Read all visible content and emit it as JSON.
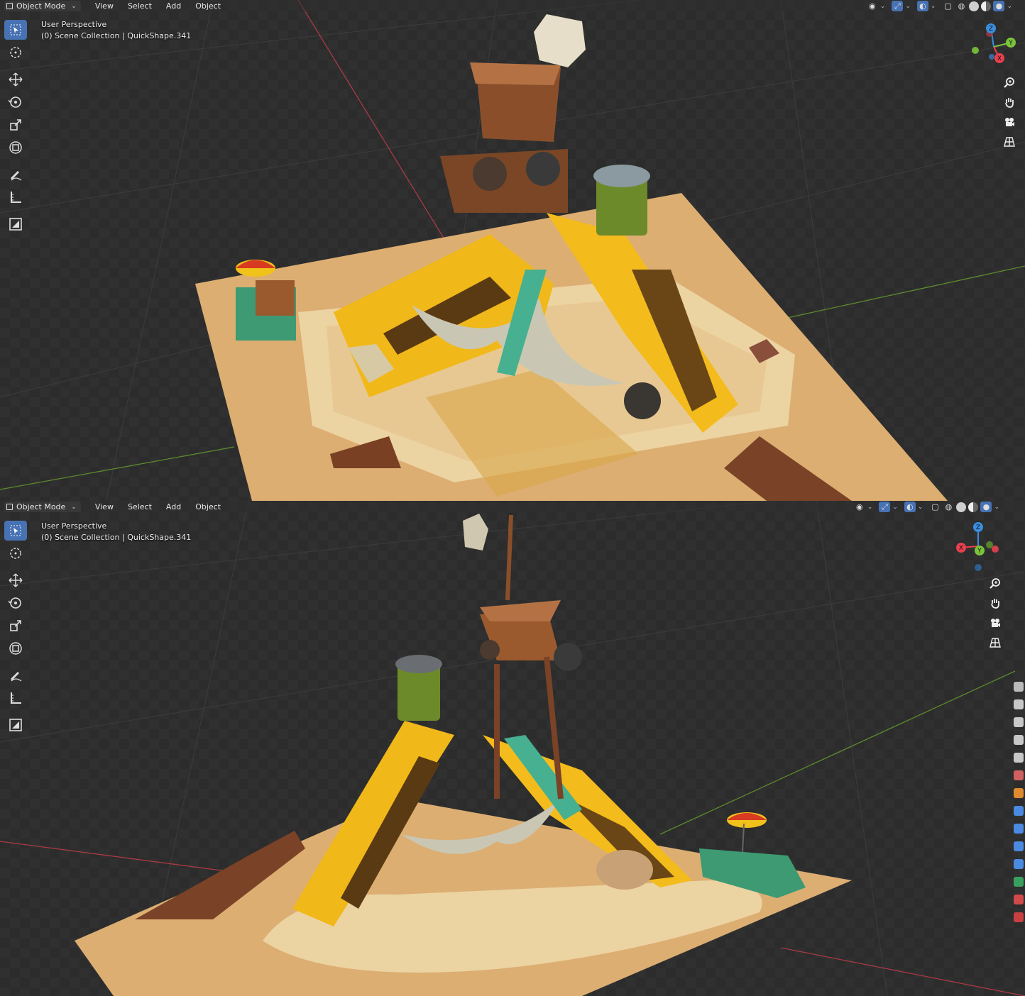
{
  "viewports": [
    {
      "id": "top",
      "header": {
        "mode": "Object Mode",
        "menus": [
          "View",
          "Select",
          "Add",
          "Object"
        ]
      },
      "overlay": {
        "perspective": "User Perspective",
        "collection": "(0) Scene Collection | QuickShape.341"
      },
      "gizmo_axes": [
        "Z",
        "Y",
        "X"
      ]
    },
    {
      "id": "bottom",
      "header": {
        "mode": "Object Mode",
        "menus": [
          "View",
          "Select",
          "Add",
          "Object"
        ]
      },
      "overlay": {
        "perspective": "User Perspective",
        "collection": "(0) Scene Collection | QuickShape.341"
      },
      "gizmo_axes": [
        "Z",
        "X",
        "Y"
      ]
    }
  ],
  "toolbar_tools": [
    "select-box",
    "cursor",
    "move",
    "rotate",
    "scale",
    "transform",
    "annotate",
    "measure",
    "add-cube"
  ],
  "nav_tools": [
    "zoom-icon",
    "pan-hand-icon",
    "camera-icon",
    "perspective-grid-icon"
  ],
  "colors": {
    "accent": "#4772b3",
    "axis_x": "#e8404f",
    "axis_y": "#7ac43a",
    "axis_z": "#3a8ede",
    "sand": "#e1b77c",
    "bus_yellow": "#f0b418",
    "rust": "#8a4a26",
    "teal": "#3da47e"
  }
}
